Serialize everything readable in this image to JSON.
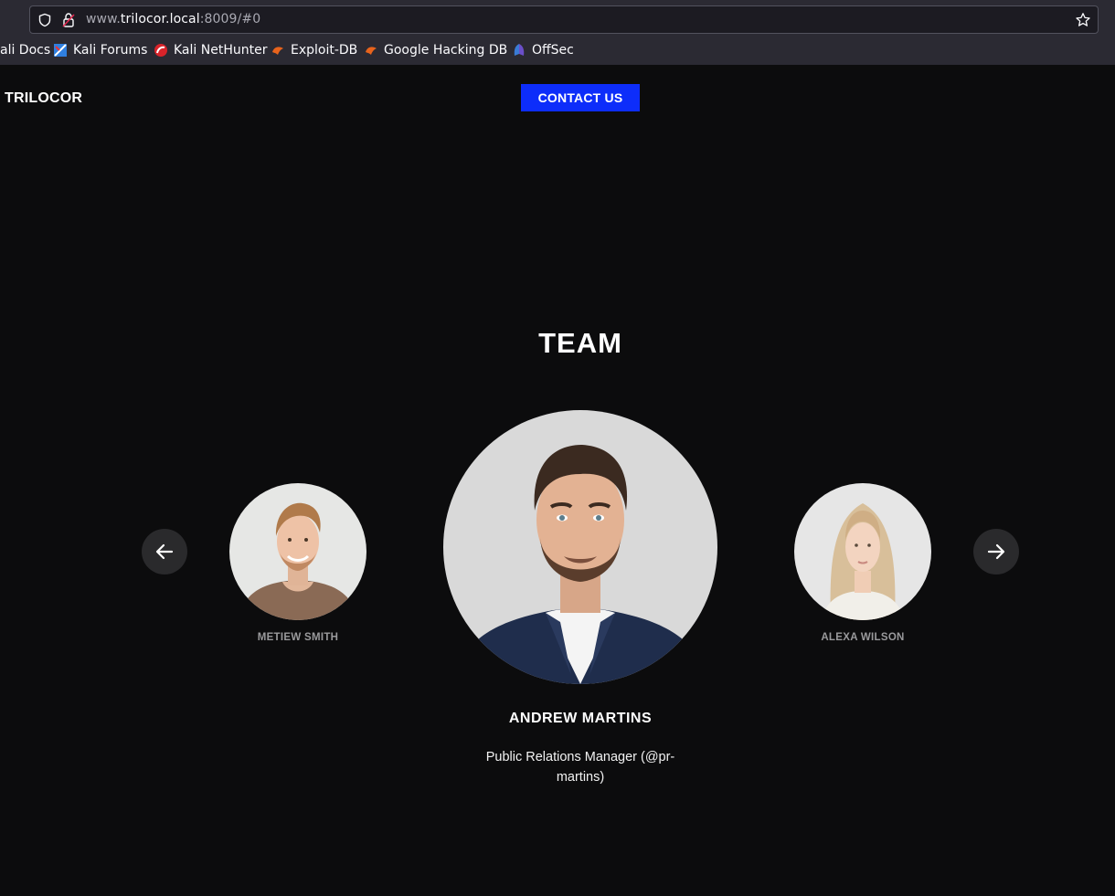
{
  "browser": {
    "url_prefix": "www.",
    "url_host": "trilocor.local",
    "url_suffix": ":8009/#0",
    "bookmarks": [
      {
        "label": "ali Docs",
        "icon": "kali-icon"
      },
      {
        "label": "Kali Forums",
        "icon": "kali-forums-icon"
      },
      {
        "label": "Kali NetHunter",
        "icon": "nethunter-icon"
      },
      {
        "label": "Exploit-DB",
        "icon": "exploit-db-icon"
      },
      {
        "label": "Google Hacking DB",
        "icon": "ghdb-icon"
      },
      {
        "label": "OffSec",
        "icon": "offsec-icon"
      }
    ]
  },
  "header": {
    "logo": "TRILOCOR",
    "contact_label": "CONTACT US"
  },
  "team": {
    "title": "TEAM",
    "left_member": "METIEW SMITH",
    "right_member": "ALEXA WILSON",
    "featured": {
      "name": "ANDREW MARTINS",
      "role": "Public Relations Manager (@pr-martins)"
    }
  },
  "colors": {
    "background": "#0c0c0d",
    "accent": "#0d2dfa",
    "chrome": "#2b2a33"
  }
}
